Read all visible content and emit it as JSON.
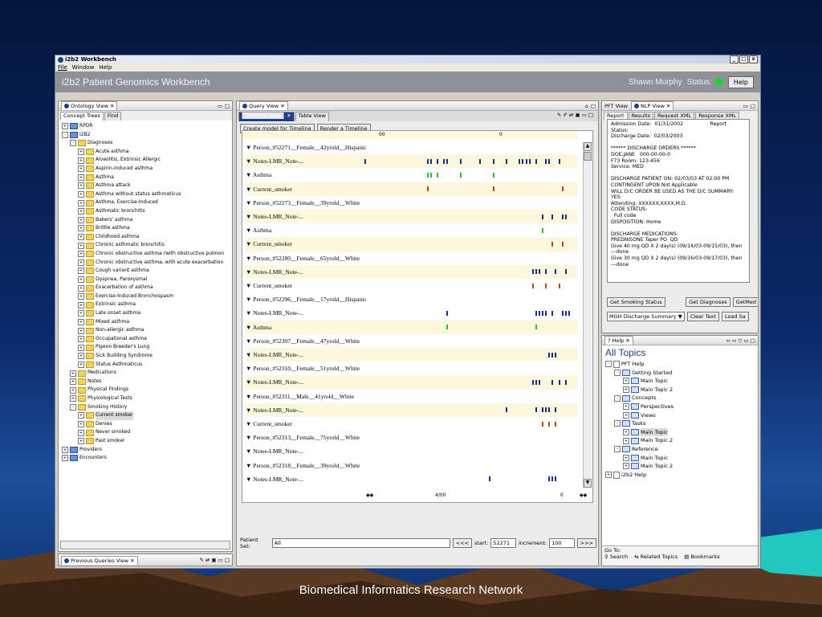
{
  "caption": "Biomedical Informatics Research Network",
  "window": {
    "title": "i2b2 Workbench",
    "controls": [
      "_",
      "□",
      "x"
    ],
    "menu": [
      "File",
      "Window",
      "Help"
    ]
  },
  "header": {
    "title": "i2b2 Patient Genomics Workbench",
    "user": "Shawn Murphy",
    "status_label": "Status:",
    "help_label": "Help"
  },
  "ontology": {
    "tab": "Ontology View",
    "subtabs": [
      "Concept Trees",
      "Find"
    ],
    "items": [
      {
        "label": "RPDR",
        "depth": 0,
        "toggle": "+",
        "kind": "root"
      },
      {
        "label": "I2B2",
        "depth": 0,
        "toggle": "-",
        "kind": "root"
      },
      {
        "label": "Diagnoses",
        "depth": 1,
        "toggle": "-",
        "kind": "folder"
      },
      {
        "label": "Acute asthma",
        "depth": 2,
        "toggle": "+",
        "kind": "folder"
      },
      {
        "label": "Alveolitis, Extrinsic Allergic",
        "depth": 2,
        "toggle": "+",
        "kind": "folder"
      },
      {
        "label": "Aspirin-induced asthma",
        "depth": 2,
        "toggle": "+",
        "kind": "folder"
      },
      {
        "label": "Asthma",
        "depth": 2,
        "toggle": "+",
        "kind": "folder"
      },
      {
        "label": "Asthma attack",
        "depth": 2,
        "toggle": "+",
        "kind": "folder"
      },
      {
        "label": "Asthma without status asthmaticus",
        "depth": 2,
        "toggle": "+",
        "kind": "folder"
      },
      {
        "label": "Asthma, Exercise-Induced",
        "depth": 2,
        "toggle": "+",
        "kind": "folder"
      },
      {
        "label": "Asthmatic bronchitis",
        "depth": 2,
        "toggle": "+",
        "kind": "folder"
      },
      {
        "label": "Bakers' asthma",
        "depth": 2,
        "toggle": "+",
        "kind": "folder"
      },
      {
        "label": "Brittle asthma",
        "depth": 2,
        "toggle": "+",
        "kind": "folder"
      },
      {
        "label": "Childhood asthma",
        "depth": 2,
        "toggle": "+",
        "kind": "folder"
      },
      {
        "label": "Chronic asthmatic bronchitis",
        "depth": 2,
        "toggle": "+",
        "kind": "folder"
      },
      {
        "label": "Chronic obstructive asthma (with obstructive pulmon",
        "depth": 2,
        "toggle": "+",
        "kind": "folder"
      },
      {
        "label": "Chronic obstructive asthma, with acute exacerbation",
        "depth": 2,
        "toggle": "+",
        "kind": "folder"
      },
      {
        "label": "Cough variant asthma",
        "depth": 2,
        "toggle": "+",
        "kind": "folder"
      },
      {
        "label": "Dyspnea, Paroxysmal",
        "depth": 2,
        "toggle": "+",
        "kind": "folder"
      },
      {
        "label": "Exacerbation of asthma",
        "depth": 2,
        "toggle": "+",
        "kind": "folder"
      },
      {
        "label": "Exercise-Induced Bronchospasm",
        "depth": 2,
        "toggle": "+",
        "kind": "folder"
      },
      {
        "label": "Extrinsic asthma",
        "depth": 2,
        "toggle": "+",
        "kind": "folder"
      },
      {
        "label": "Late onset asthma",
        "depth": 2,
        "toggle": "+",
        "kind": "folder"
      },
      {
        "label": "Mixed asthma",
        "depth": 2,
        "toggle": "+",
        "kind": "folder"
      },
      {
        "label": "Non-allergic asthma",
        "depth": 2,
        "toggle": "+",
        "kind": "folder"
      },
      {
        "label": "Occupational asthma",
        "depth": 2,
        "toggle": "+",
        "kind": "folder"
      },
      {
        "label": "Pigeon Breeder's Lung",
        "depth": 2,
        "toggle": "+",
        "kind": "folder"
      },
      {
        "label": "Sick Building Syndrome",
        "depth": 2,
        "toggle": "+",
        "kind": "folder"
      },
      {
        "label": "Status Asthmaticus",
        "depth": 2,
        "toggle": "+",
        "kind": "folder"
      },
      {
        "label": "Medications",
        "depth": 1,
        "toggle": "+",
        "kind": "folder"
      },
      {
        "label": "Notes",
        "depth": 1,
        "toggle": "+",
        "kind": "folder"
      },
      {
        "label": "Physical Findings",
        "depth": 1,
        "toggle": "+",
        "kind": "folder"
      },
      {
        "label": "Physiological Tests",
        "depth": 1,
        "toggle": "+",
        "kind": "folder"
      },
      {
        "label": "Smoking History",
        "depth": 1,
        "toggle": "-",
        "kind": "folder"
      },
      {
        "label": "Current smoker",
        "depth": 2,
        "toggle": "+",
        "kind": "folder"
      },
      {
        "label": "Denies",
        "depth": 2,
        "toggle": "+",
        "kind": "folder"
      },
      {
        "label": "Never smoked",
        "depth": 2,
        "toggle": "+",
        "kind": "folder"
      },
      {
        "label": "Past smoker",
        "depth": 2,
        "toggle": "+",
        "kind": "folder"
      },
      {
        "label": "Providers",
        "depth": 0,
        "toggle": "+",
        "kind": "root"
      },
      {
        "label": "Encounters",
        "depth": 0,
        "toggle": "+",
        "kind": "root"
      }
    ],
    "bottom_tab": "Previous Queries View"
  },
  "query": {
    "tab": "Query View",
    "subtabs": [
      "Timeline View",
      "Table View"
    ],
    "buttons": [
      "Create model for Timeline",
      "Render a Timeline"
    ],
    "top_labels": [
      "00",
      "0"
    ],
    "bottom_labels": [
      "◆◆",
      "4/00",
      "0",
      "◆◆"
    ],
    "rows": [
      {
        "label": "▼ Person_#52271__Female__42yrold__Hispanic",
        "kind": "person",
        "marks": []
      },
      {
        "label": "▼ Notes-LMR_Note-...",
        "kind": "cat",
        "marks": [
          {
            "x": 0.36,
            "c": "#1a2a8a"
          },
          {
            "x": 0.55,
            "c": "#1a2a8a"
          },
          {
            "x": 0.56,
            "c": "#1a2a8a"
          },
          {
            "x": 0.58,
            "c": "#1a2a8a"
          },
          {
            "x": 0.6,
            "c": "#1a2a8a"
          },
          {
            "x": 0.61,
            "c": "#1a2a8a"
          },
          {
            "x": 0.65,
            "c": "#1a2a8a"
          },
          {
            "x": 0.71,
            "c": "#1a2a8a"
          },
          {
            "x": 0.75,
            "c": "#1a2a8a"
          },
          {
            "x": 0.79,
            "c": "#1a2a8a"
          },
          {
            "x": 0.83,
            "c": "#1a2a8a"
          },
          {
            "x": 0.84,
            "c": "#1a2a8a"
          },
          {
            "x": 0.85,
            "c": "#1a2a8a"
          },
          {
            "x": 0.86,
            "c": "#1a2a8a"
          },
          {
            "x": 0.88,
            "c": "#1a2a8a"
          },
          {
            "x": 0.91,
            "c": "#1a2a8a"
          },
          {
            "x": 0.92,
            "c": "#1a2a8a"
          },
          {
            "x": 0.95,
            "c": "#1a2a8a"
          }
        ]
      },
      {
        "label": "▼ Asthma",
        "kind": "cat",
        "marks": [
          {
            "x": 0.55,
            "c": "#22c02a"
          },
          {
            "x": 0.56,
            "c": "#22c02a"
          },
          {
            "x": 0.58,
            "c": "#22c02a"
          },
          {
            "x": 0.65,
            "c": "#22c02a"
          },
          {
            "x": 0.75,
            "c": "#22c02a"
          }
        ]
      },
      {
        "label": "▼ Current_smoker",
        "kind": "cat",
        "marks": [
          {
            "x": 0.55,
            "c": "#b04a10"
          },
          {
            "x": 0.75,
            "c": "#b04a10"
          },
          {
            "x": 0.96,
            "c": "#b04a10"
          }
        ]
      },
      {
        "label": "▼ Person_#52273__Female__39yrold__White",
        "kind": "person",
        "marks": []
      },
      {
        "label": "▼ Notes-LMR_Note-...",
        "kind": "cat",
        "marks": [
          {
            "x": 0.9,
            "c": "#1a2a8a"
          },
          {
            "x": 0.93,
            "c": "#1a2a8a"
          },
          {
            "x": 0.96,
            "c": "#1a2a8a"
          },
          {
            "x": 0.97,
            "c": "#1a2a8a"
          }
        ]
      },
      {
        "label": "▼ Asthma",
        "kind": "cat",
        "marks": [
          {
            "x": 0.9,
            "c": "#22c02a"
          }
        ]
      },
      {
        "label": "▼ Current_smoker",
        "kind": "cat",
        "marks": [
          {
            "x": 0.93,
            "c": "#b04a10"
          },
          {
            "x": 0.96,
            "c": "#b04a10"
          }
        ]
      },
      {
        "label": "▼ Person_#52280__Female__65yrold__White",
        "kind": "person",
        "marks": []
      },
      {
        "label": "▼ Notes-LMR_Note-...",
        "kind": "cat",
        "marks": [
          {
            "x": 0.87,
            "c": "#1a2a8a"
          },
          {
            "x": 0.88,
            "c": "#1a2a8a"
          },
          {
            "x": 0.89,
            "c": "#1a2a8a"
          },
          {
            "x": 0.91,
            "c": "#1a2a8a"
          },
          {
            "x": 0.94,
            "c": "#1a2a8a"
          },
          {
            "x": 0.97,
            "c": "#1a2a8a"
          }
        ]
      },
      {
        "label": "▼ Current_smoker",
        "kind": "cat",
        "marks": [
          {
            "x": 0.87,
            "c": "#b04a10"
          },
          {
            "x": 0.91,
            "c": "#b04a10"
          },
          {
            "x": 0.95,
            "c": "#b04a10"
          }
        ]
      },
      {
        "label": "▼ Person_#52296__Female__17yrold__Hispanic",
        "kind": "person",
        "marks": []
      },
      {
        "label": "▼ Notes-LMR_Note-...",
        "kind": "cat",
        "marks": [
          {
            "x": 0.61,
            "c": "#1a2a8a"
          },
          {
            "x": 0.88,
            "c": "#1a2a8a"
          },
          {
            "x": 0.89,
            "c": "#1a2a8a"
          },
          {
            "x": 0.9,
            "c": "#1a2a8a"
          },
          {
            "x": 0.91,
            "c": "#1a2a8a"
          },
          {
            "x": 0.93,
            "c": "#1a2a8a"
          },
          {
            "x": 0.96,
            "c": "#1a2a8a"
          },
          {
            "x": 0.97,
            "c": "#1a2a8a"
          },
          {
            "x": 0.98,
            "c": "#1a2a8a"
          }
        ]
      },
      {
        "label": "▼ Asthma",
        "kind": "cat",
        "marks": [
          {
            "x": 0.61,
            "c": "#22c02a"
          },
          {
            "x": 0.88,
            "c": "#22c02a"
          }
        ]
      },
      {
        "label": "▼ Person_#52307__Female__47yrold__White",
        "kind": "person",
        "marks": []
      },
      {
        "label": "▼ Notes-LMR_Note-...",
        "kind": "cat",
        "marks": [
          {
            "x": 0.92,
            "c": "#1a2a8a"
          },
          {
            "x": 0.93,
            "c": "#1a2a8a"
          },
          {
            "x": 0.94,
            "c": "#1a2a8a"
          }
        ]
      },
      {
        "label": "▼ Person_#52310__Female__51yrold__White",
        "kind": "person",
        "marks": []
      },
      {
        "label": "▼ Notes-LMR_Note-...",
        "kind": "cat",
        "marks": [
          {
            "x": 0.87,
            "c": "#1a2a8a"
          },
          {
            "x": 0.88,
            "c": "#1a2a8a"
          },
          {
            "x": 0.89,
            "c": "#1a2a8a"
          },
          {
            "x": 0.93,
            "c": "#1a2a8a"
          },
          {
            "x": 0.95,
            "c": "#1a2a8a"
          },
          {
            "x": 0.97,
            "c": "#1a2a8a"
          }
        ]
      },
      {
        "label": "▼ Person_#52311__Male__41yrold__White",
        "kind": "person",
        "marks": []
      },
      {
        "label": "▼ Notes-LMR_Note-...",
        "kind": "cat",
        "marks": [
          {
            "x": 0.79,
            "c": "#1a2a8a"
          },
          {
            "x": 0.88,
            "c": "#1a2a8a"
          },
          {
            "x": 0.9,
            "c": "#1a2a8a"
          },
          {
            "x": 0.91,
            "c": "#1a2a8a"
          },
          {
            "x": 0.92,
            "c": "#1a2a8a"
          },
          {
            "x": 0.94,
            "c": "#1a2a8a"
          }
        ]
      },
      {
        "label": "▼ Current_smoker",
        "kind": "cat",
        "marks": [
          {
            "x": 0.9,
            "c": "#b04a10"
          },
          {
            "x": 0.92,
            "c": "#b04a10"
          },
          {
            "x": 0.94,
            "c": "#b04a10"
          }
        ]
      },
      {
        "label": "▼ Person_#52313__Female__75yrold__White",
        "kind": "person",
        "marks": []
      },
      {
        "label": "▼ Notes-LMR_Note-...",
        "kind": "cat",
        "marks": []
      },
      {
        "label": "▼ Person_#52318__Female__39yrold__White",
        "kind": "person",
        "marks": []
      },
      {
        "label": "▼ Notes-LMR_Note-...",
        "kind": "cat",
        "marks": [
          {
            "x": 0.74,
            "c": "#1a2a8a"
          },
          {
            "x": 0.92,
            "c": "#1a2a8a"
          },
          {
            "x": 0.93,
            "c": "#1a2a8a"
          },
          {
            "x": 0.94,
            "c": "#1a2a8a"
          }
        ]
      }
    ],
    "footer": {
      "patient_set_label": "Patient Set:",
      "patient_set_value": "All",
      "prev": "<<<",
      "start_label": "start:",
      "start_value": "52271",
      "increment_label": "increment:",
      "increment_value": "100",
      "next": ">>>"
    }
  },
  "right": {
    "tabs": [
      "PFT View",
      "NLP View"
    ],
    "subtabs": [
      "Report",
      "Results",
      "Request XML",
      "Response XML"
    ],
    "report_text": "Admission Date:  01/31/2002                 Report\nStatus:\nDischarge Date:  02/03/2003\n\n****** DISCHARGE ORDERS ******\nDOE,JANE   000-00-00-0\nF73 Room: 123-456\nService: MED\n\nDISCHARGE PATIENT ON: 02/03/03 AT 02:00 PM\nCONTINGENT UPON Not Applicable\nWILL D/C ORDER BE USED AS THE D/C SUMMARY:\nYES\nAttending: XXXXXX,XXXX,M.D.\nCODE STATUS:\n  Full code\nDISPOSITION: Home\n\nDISCHARGE MEDICATIONS:\nPREDNISONE Taper PO  QD\nGive 40 mg QD X 2 day(s) (09/14/03-09/15/03), then\n---done\nGive 30 mg QD X 2 day(s) (09/16/03-09/17/03), then\n---done",
    "buttons_row1": [
      "Get Smoking Status",
      "Get Diagnoses",
      "GetMed"
    ],
    "select_value": "MGH Discharge Summary",
    "buttons_row2": [
      "Clear Text",
      "Load Sa"
    ],
    "help": {
      "tab": "Help",
      "heading": "All Topics",
      "items": [
        {
          "label": "PFT Help",
          "depth": 0,
          "toggle": "-",
          "kind": "page"
        },
        {
          "label": "Getting Started",
          "depth": 1,
          "toggle": "-",
          "kind": "book"
        },
        {
          "label": "Main Topic",
          "depth": 2,
          "toggle": "+",
          "kind": "book"
        },
        {
          "label": "Main Topic 2",
          "depth": 2,
          "toggle": "+",
          "kind": "book"
        },
        {
          "label": "Concepts",
          "depth": 1,
          "toggle": "-",
          "kind": "book"
        },
        {
          "label": "Perspectives",
          "depth": 2,
          "toggle": "+",
          "kind": "book"
        },
        {
          "label": "Views",
          "depth": 2,
          "toggle": "+",
          "kind": "book"
        },
        {
          "label": "Tasks",
          "depth": 1,
          "toggle": "-",
          "kind": "book"
        },
        {
          "label": "Main Topic",
          "depth": 2,
          "toggle": "+",
          "kind": "book",
          "selected": true
        },
        {
          "label": "Main Topic 2",
          "depth": 2,
          "toggle": "+",
          "kind": "book"
        },
        {
          "label": "Reference",
          "depth": 1,
          "toggle": "-",
          "kind": "book"
        },
        {
          "label": "Main Topic",
          "depth": 2,
          "toggle": "+",
          "kind": "book"
        },
        {
          "label": "Main Topic 2",
          "depth": 2,
          "toggle": "+",
          "kind": "book"
        },
        {
          "label": "i2b2 Help",
          "depth": 0,
          "toggle": "+",
          "kind": "page"
        }
      ],
      "goto": "Go To:",
      "links": [
        "Search",
        "Related Topics",
        "Bookmarks"
      ]
    }
  }
}
